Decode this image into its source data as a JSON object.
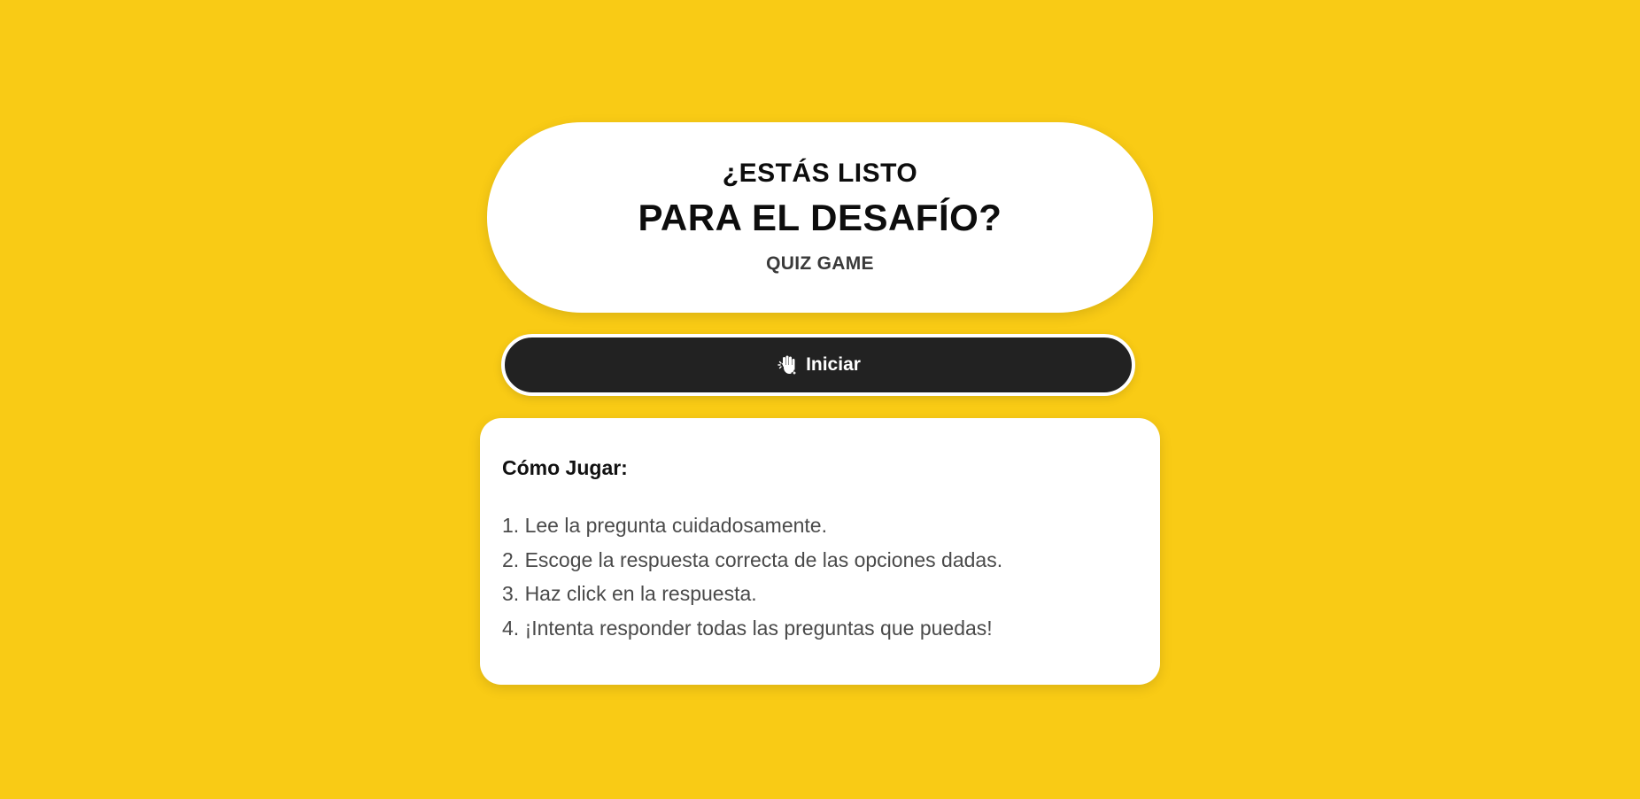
{
  "hero": {
    "line1": "¿ESTÁS LISTO",
    "line2": "PARA EL DESAFÍO?",
    "subtitle": "QUIZ GAME"
  },
  "start_button": {
    "icon": "waving-hand-icon",
    "label": "Iniciar"
  },
  "how_to_play": {
    "title": "Cómo Jugar:",
    "steps": [
      "1. Lee la pregunta cuidadosamente.",
      "2. Escoge la respuesta correcta de las opciones dadas.",
      "3. Haz click en la respuesta.",
      "4. ¡Intenta responder todas las preguntas que puedas!"
    ]
  },
  "colors": {
    "background": "#f9cb15",
    "card": "#ffffff",
    "button": "#222222",
    "text_dark": "#0d0d0d",
    "text_muted": "#4a4a4a"
  }
}
